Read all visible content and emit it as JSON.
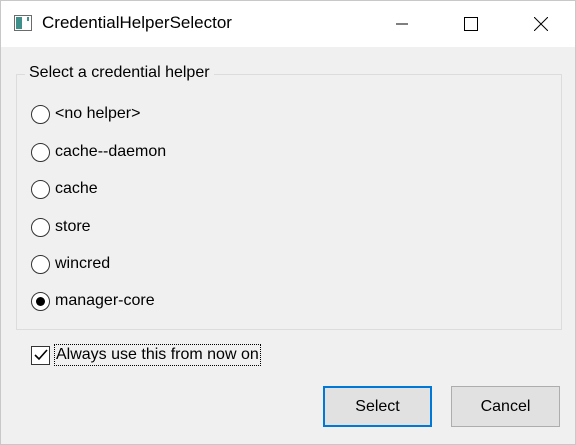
{
  "window": {
    "title": "CredentialHelperSelector",
    "app_icon": "app-window-icon",
    "controls": [
      "minimize-icon",
      "maximize-icon",
      "close-icon"
    ]
  },
  "group": {
    "label": "Select a credential helper",
    "options": [
      {
        "label": "<no helper>",
        "checked": false
      },
      {
        "label": "cache--daemon",
        "checked": false
      },
      {
        "label": "cache",
        "checked": false
      },
      {
        "label": "store",
        "checked": false
      },
      {
        "label": "wincred",
        "checked": false
      },
      {
        "label": "manager-core",
        "checked": true
      }
    ]
  },
  "always_use": {
    "label": "Always use this from now on",
    "checked": true
  },
  "buttons": {
    "select": "Select",
    "cancel": "Cancel"
  },
  "colors": {
    "default_button_border": "#0078d7",
    "dialog_background": "#f0f0f0"
  }
}
